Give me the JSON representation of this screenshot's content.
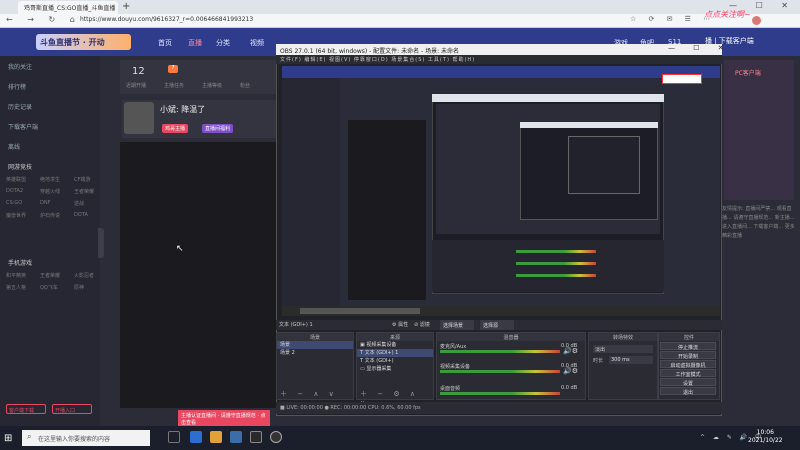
{
  "browser": {
    "tab_title": "鸡哥斯直播_CS:GO直播_斗鱼直播",
    "new_tab": "+",
    "window_controls": "— ☐ ✕",
    "nav": "← → ↻ ⌂",
    "url": "https://www.douyu.com/9616327_r=0.006466841993213",
    "toolbar_icons": "☆ ⟳ ✉ ☰ ⋯",
    "watermark": "点点关注啊~"
  },
  "douyu": {
    "logo": "斗鱼直播节 · 开动",
    "nav": [
      "首页",
      "直播",
      "分类",
      "视频",
      "游戏",
      "鱼吧",
      "S11"
    ],
    "header_right": "播 | 下载客户端",
    "sidebar_items": [
      "我的关注",
      "排行榜",
      "历史记录",
      "下载客户端",
      "离线"
    ],
    "sidebar_section1": "网游竞技",
    "sidebar_grid1": [
      "英雄联盟",
      "绝地求生",
      "CF端游",
      "DOTA2",
      "穿越火线",
      "王者荣耀",
      "CS:GO",
      "DNF",
      "逆战",
      "魔兽世界",
      "炉石传说",
      "DOTA"
    ],
    "sidebar_section2": "手机游戏",
    "sidebar_grid2": [
      "和平精英",
      "王者荣耀",
      "火影忍者",
      "第五人格",
      "QQ飞车",
      "原神"
    ],
    "sidebar_btn1": "客户端下载",
    "sidebar_btn2": "开播入口",
    "stats": {
      "count": "12",
      "count_label": "近期开播",
      "level_badge": "7",
      "label2": "主播任务",
      "label3": "主播等级",
      "label4": "粉丝"
    },
    "streamer_name": "小斌: 降温了",
    "streamer_tags": [
      "鸡哥主播",
      "直播间福利"
    ],
    "promo_badge": "PC客户端",
    "right_text": "友情提示: 直播间严禁... 观看直播... 请遵守直播规范... 新主播... 进入直播间... 下载客户端... 更多精彩直播",
    "bottom_banner": "主播认证直播间 · 请遵守直播规范 · 点击查看",
    "cursor": "↖"
  },
  "obs": {
    "title": "OBS 27.0.1 (64 bit, windows) - 配置文件: 未命名 - 场景: 未命名",
    "window_controls": "— ☐ ✕",
    "menu": "文件(F)   编辑(E)   视图(V)   停靠窗口(D)   场景集合(S)   工具(T)   帮助(H)",
    "current_scene": "文本 (GDI+) 1",
    "properties_btn": "⚙ 属性",
    "filters_btn": "⊘ 滤镜",
    "transition_scene": "选择场景",
    "transition_source": "选择源",
    "scenes_title": "场景",
    "scenes": [
      "场景",
      "场景 2"
    ],
    "sources_title": "来源",
    "sources": [
      "视频采集设备",
      "文本 (GDI+) 1",
      "文本 (GDI+)",
      "显示器采集"
    ],
    "mixer_title": "混音器",
    "mixer": [
      {
        "name": "麦克风/Aux",
        "db": "0.0 dB"
      },
      {
        "name": "视频采集设备",
        "db": "0.0 dB"
      },
      {
        "name": "桌面音频",
        "db": "0.0 dB"
      }
    ],
    "transitions_title": "转场特效",
    "transition_type": "淡出",
    "duration_label": "时长",
    "duration": "300 ms",
    "controls_title": "控件",
    "controls": [
      "停止推流",
      "开始录制",
      "启动虚拟摄像机",
      "工作室模式",
      "设置",
      "退出"
    ],
    "status": "■ LIVE: 00:00:00   ● REC: 00:00:00   CPU: 0.6%, 60.00 fps"
  },
  "taskbar": {
    "start": "⊞",
    "search_placeholder": "在这里输入你要搜索的内容",
    "search_icon": "⌕",
    "systray": "^ ☁ ✎ 🔊 中",
    "time": "10:06",
    "date": "2021/10/22"
  }
}
